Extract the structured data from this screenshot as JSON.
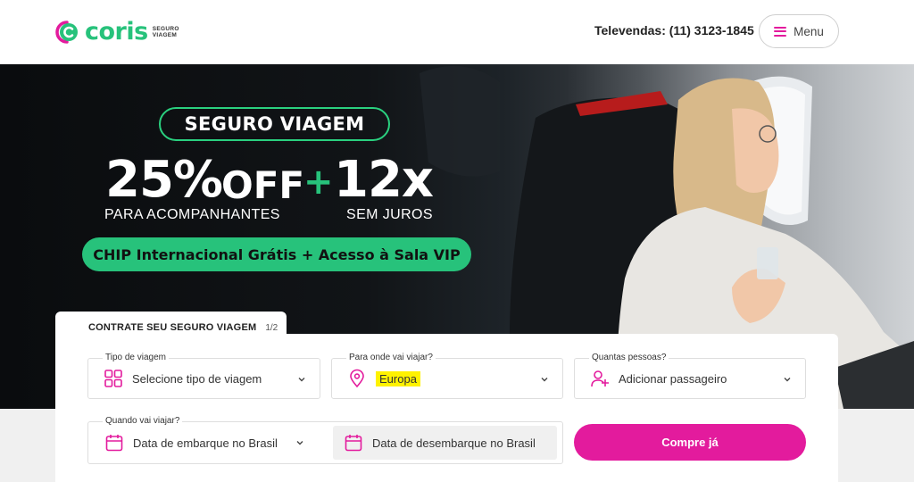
{
  "header": {
    "logo_text": "coris",
    "logo_sub_line1": "SEGURO",
    "logo_sub_line2": "VIAGEM",
    "phone": "Televendas: (11) 3123-1845",
    "menu_label": "Menu"
  },
  "hero": {
    "badge": "SEGURO VIAGEM",
    "discount": "25%",
    "off": "OFF",
    "plus": "+",
    "installments": "12x",
    "discount_sub": "PARA ACOMPANHANTES",
    "installments_sub": "SEM JUROS",
    "chip_banner": "CHIP Internacional Grátis + Acesso à Sala VIP"
  },
  "form": {
    "tab_title": "CONTRATE SEU SEGURO VIAGEM",
    "tab_step": "1/2",
    "trip_type": {
      "label": "Tipo de viagem",
      "value": "Selecione tipo de viagem",
      "icon": "grid-icon"
    },
    "destination": {
      "label": "Para onde vai viajar?",
      "value": "Europa",
      "icon": "map-pin-icon"
    },
    "passengers": {
      "label": "Quantas pessoas?",
      "value": "Adicionar passageiro",
      "icon": "user-plus-icon"
    },
    "dates": {
      "label": "Quando vai viajar?",
      "departure": "Data de embarque no Brasil",
      "return": "Data de desembarque no Brasil",
      "icon": "calendar-icon"
    },
    "submit_label": "Compre já"
  },
  "colors": {
    "brand_green": "#27c27b",
    "brand_pink": "#e31b9d",
    "highlight": "#fff200"
  }
}
